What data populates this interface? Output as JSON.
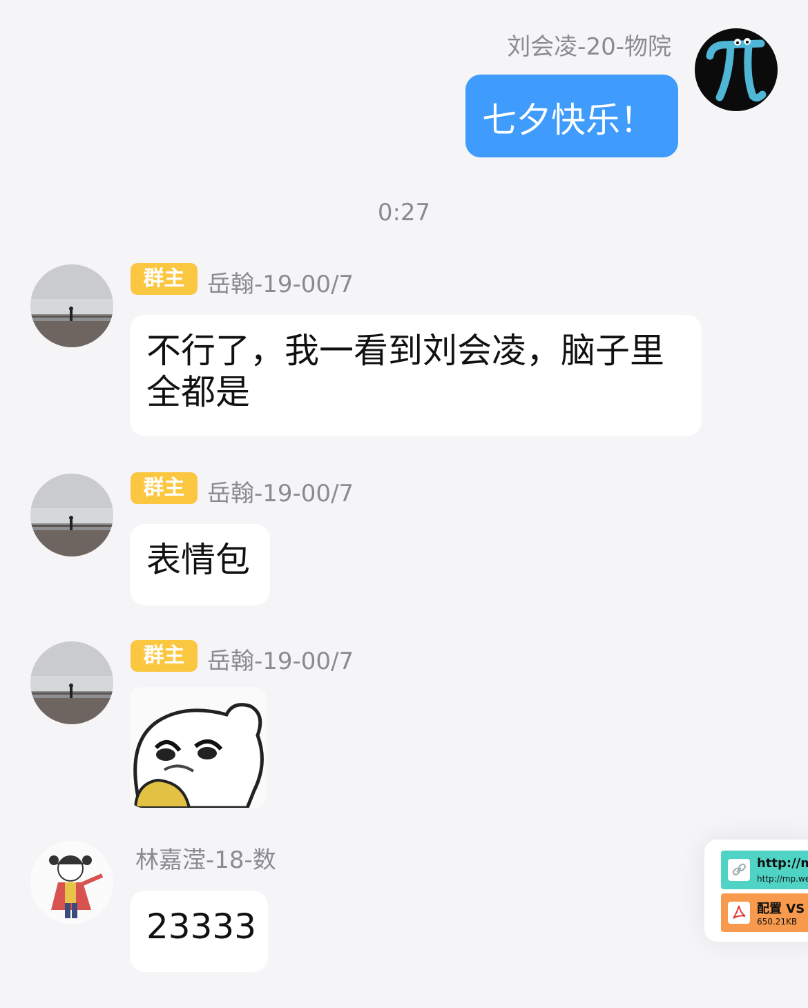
{
  "outgoing": {
    "sender": "刘会凌-20-物院",
    "text": "七夕快乐！"
  },
  "timestamp": "0:27",
  "messages": [
    {
      "badge": "群主",
      "sender": "岳翰-19-00/7",
      "text": "不行了，我一看到刘会凌，脑子里全都是"
    },
    {
      "badge": "群主",
      "sender": "岳翰-19-00/7",
      "text": "表情包"
    },
    {
      "badge": "群主",
      "sender": "岳翰-19-00/7",
      "type": "sticker"
    },
    {
      "sender": "林嘉滢-18-数",
      "text": "23333"
    }
  ],
  "floating_panel": {
    "link": {
      "title": "http://m",
      "subtitle": "http://mp.we",
      "icon": "link-icon",
      "color": "#4fd3c4"
    },
    "file": {
      "title": "配置 VS C",
      "size": "650.21KB",
      "icon": "pdf-icon",
      "color": "#f79a4d"
    }
  },
  "colors": {
    "accent": "#3f9cfc",
    "badge": "#fbc640",
    "background": "#f5f5f7"
  }
}
